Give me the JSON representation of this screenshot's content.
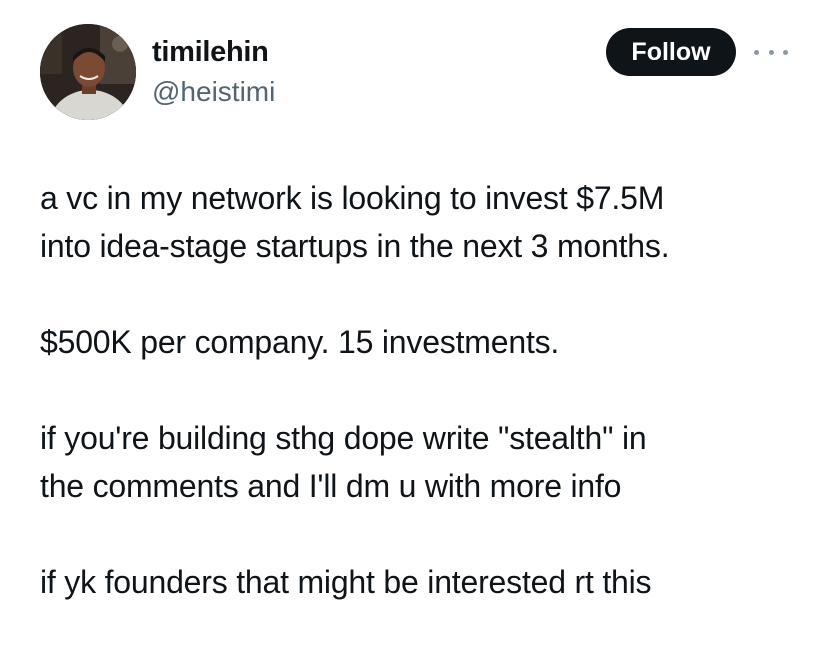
{
  "author": {
    "display_name": "timilehin",
    "handle": "@heistimi"
  },
  "actions": {
    "follow_label": "Follow",
    "more_icon": "more-dots-icon"
  },
  "tweet": {
    "paragraphs": [
      "a vc in my network is looking to invest $7.5M\ninto idea-stage startups in the next 3 months.",
      "$500K per company. 15 investments.",
      "if you're building sthg dope write \"stealth\" in\nthe comments and I'll dm u with more info",
      "if yk founders that might be interested rt this"
    ]
  },
  "colors": {
    "text": "#0f1419",
    "secondary": "#536471",
    "button_bg": "#0f1419",
    "button_text": "#ffffff"
  }
}
